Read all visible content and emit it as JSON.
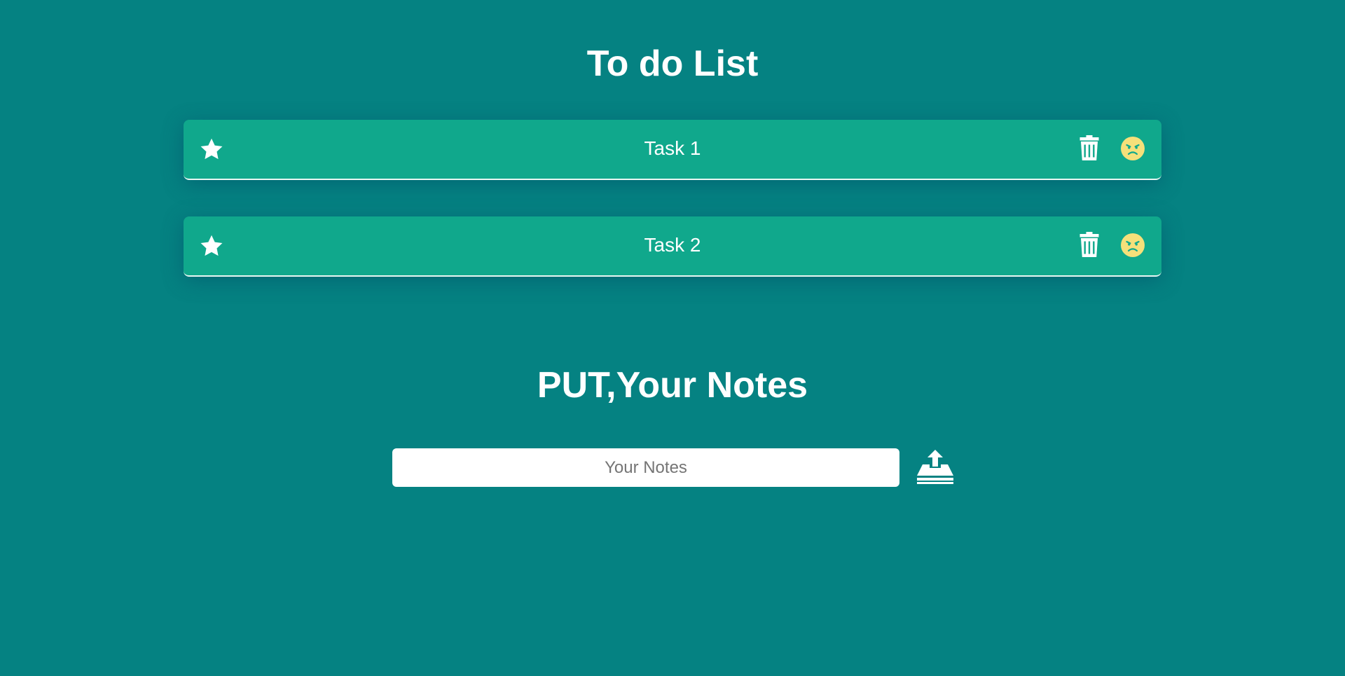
{
  "todo": {
    "title": "To do List",
    "tasks": [
      {
        "label": "Task 1"
      },
      {
        "label": "Task 2"
      }
    ]
  },
  "notes": {
    "title": "PUT,Your Notes",
    "input_value": "",
    "input_placeholder": "Your Notes"
  },
  "icons": {
    "task_left": "star-icon",
    "task_delete": "trash-icon",
    "task_mood": "angry-face-icon",
    "notes_submit": "upload-icon"
  },
  "colors": {
    "background": "#058282",
    "task_background": "#10a88c",
    "mood_icon": "#f5e07a",
    "text": "#ffffff"
  }
}
